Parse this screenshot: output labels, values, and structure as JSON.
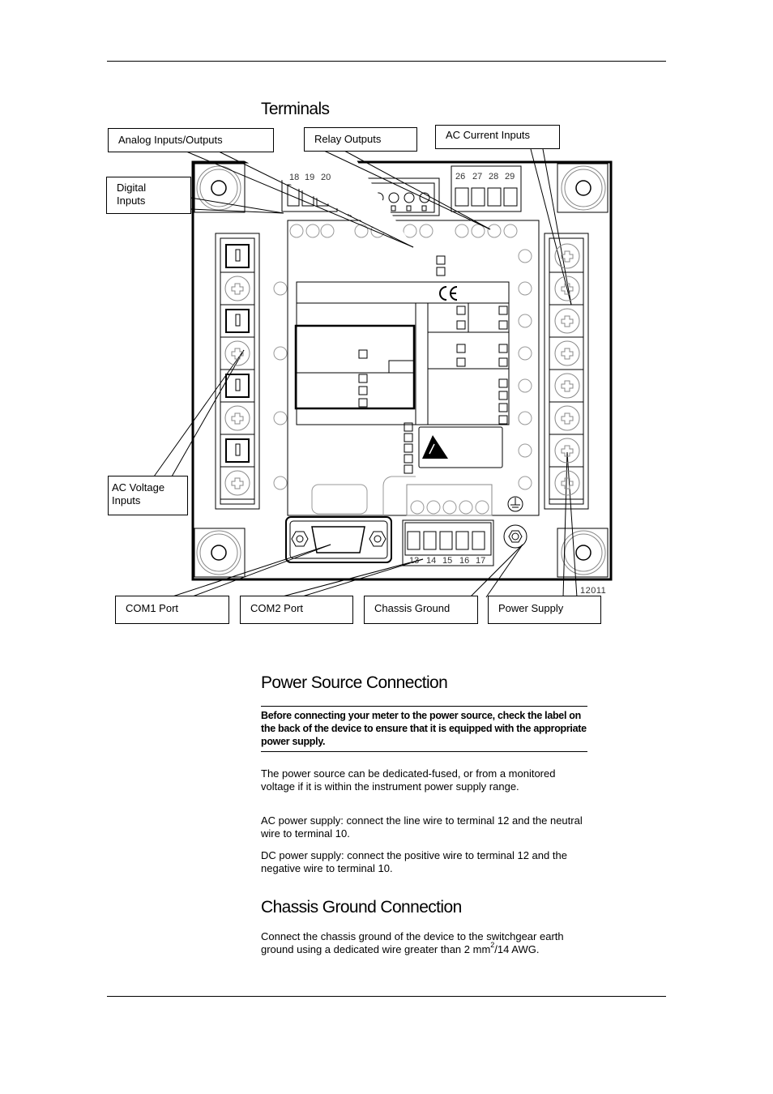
{
  "page": {
    "sections": {
      "terminals": {
        "title": "Terminals"
      },
      "power": {
        "title": "Power Source Connection"
      },
      "chassis": {
        "title": "Chassis Ground Connection"
      }
    },
    "diagram": {
      "callouts": {
        "analog": "Analog Inputs/Outputs",
        "relay": "Relay Outputs",
        "ac_current": "AC Current Inputs",
        "digital_1": "Digital",
        "digital_2": "Inputs",
        "ac_voltage_1": "AC Voltage",
        "ac_voltage_2": "Inputs",
        "com1": "COM1 Port",
        "com2": "COM2 Port",
        "chassis_ground": "Chassis Ground",
        "power_supply": "Power Supply"
      },
      "terminal_numbers": {
        "digital": [
          "18",
          "19",
          "20"
        ],
        "current": [
          "26",
          "27",
          "28",
          "29"
        ],
        "power": [
          "13",
          "14",
          "15",
          "16",
          "17"
        ]
      },
      "figure_code": "12011",
      "icons": [
        "ce-mark-icon",
        "esd-warning-icon",
        "ground-symbol-icon"
      ]
    },
    "power_note": "Before connecting your meter to the power source, check the label on the back of the device to ensure that it is equipped with the appropriate power supply.",
    "power_paragraphs": [
      "The power source can be dedicated-fused, or from a monitored voltage if it is within the instrument power supply range.",
      "AC power supply: connect the line wire to terminal 12 and the neutral wire to terminal 10.",
      "DC power supply: connect the positive wire to terminal 12 and the negative wire to terminal 10."
    ],
    "chassis_paragraph": {
      "before": "Connect the chassis ground of the device to the switchgear earth ground using a dedicated wire greater than 2 mm",
      "superscript": "2",
      "after": "/14 AWG."
    }
  }
}
